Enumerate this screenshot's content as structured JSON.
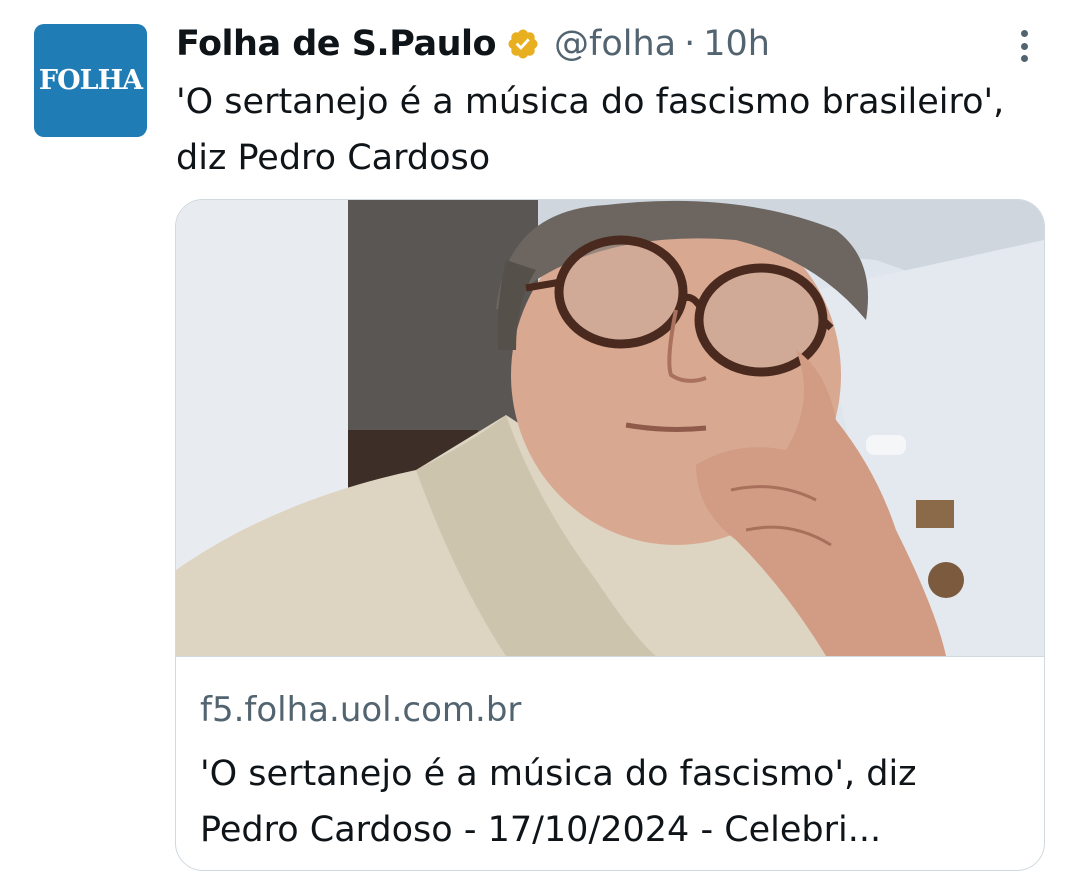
{
  "account": {
    "avatar_text": "FOLHA",
    "display_name": "Folha de S.Paulo",
    "verified_icon": "verified-gold-badge",
    "handle": "@folha",
    "separator": "·",
    "time": "10h"
  },
  "tweet": {
    "text": "'O sertanejo é a música do fascismo brasileiro', diz Pedro Cardoso"
  },
  "card": {
    "domain": "f5.folha.uol.com.br",
    "title": "'O sertanejo é a música do fascismo', diz Pedro Cardoso - 17/10/2024 - Celebri..."
  },
  "icons": {
    "more": "more-vertical-icon"
  },
  "colors": {
    "avatar_bg": "#1f7cb4",
    "verified_badge": "#e8b021",
    "secondary_text": "#536471",
    "border": "#cfd9de"
  }
}
